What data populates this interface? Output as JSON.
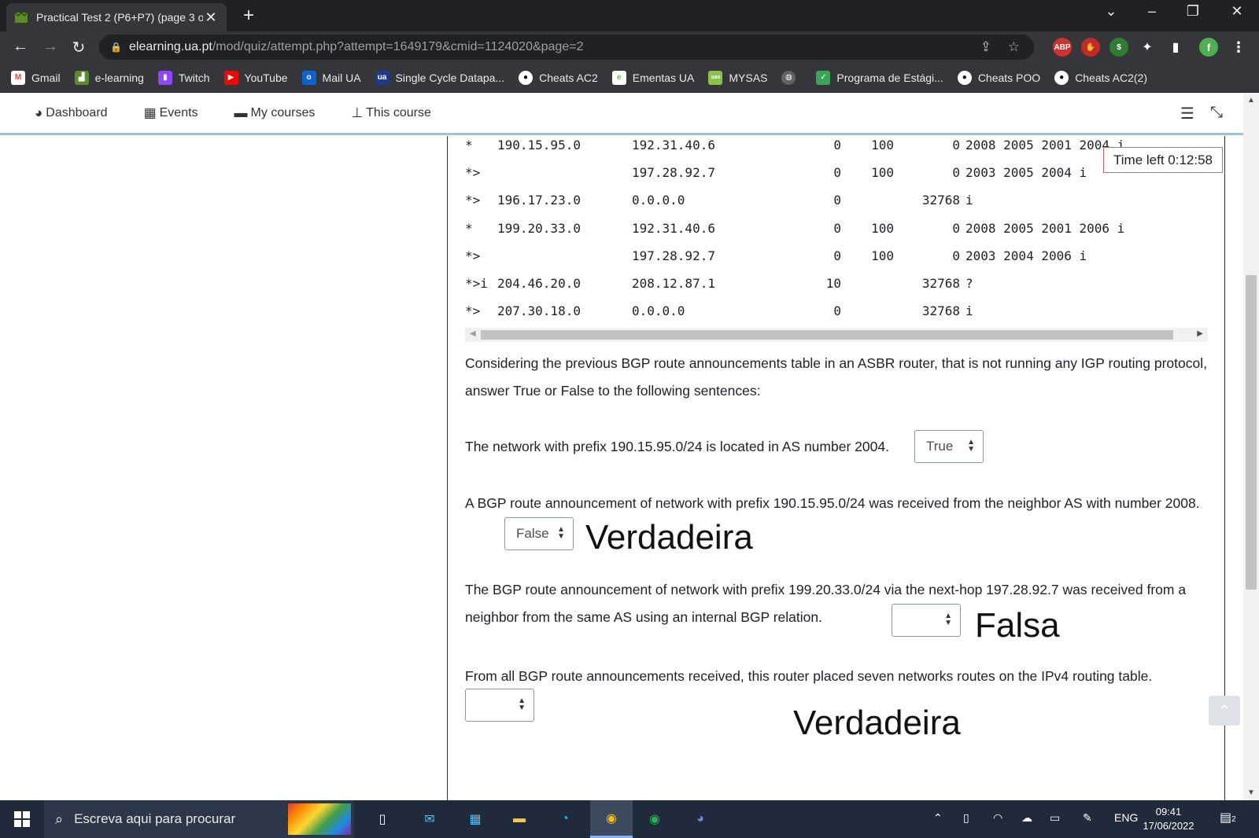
{
  "browser": {
    "tab_title": "Practical Test 2 (P6+P7) (page 3 o",
    "url_host": "elearning.ua.pt",
    "url_path": "/mod/quiz/attempt.php?attempt=1649179&cmid=1124020&page=2",
    "bookmarks": [
      {
        "label": "Gmail",
        "icon": "gmail-icon",
        "color": "#ea4335"
      },
      {
        "label": "e-learning",
        "icon": "elearning-icon",
        "color": "#5b8c2a"
      },
      {
        "label": "Twitch",
        "icon": "twitch-icon",
        "color": "#9146ff"
      },
      {
        "label": "YouTube",
        "icon": "youtube-icon",
        "color": "#ff0000"
      },
      {
        "label": "Mail UA",
        "icon": "outlook-icon",
        "color": "#0a64d6"
      },
      {
        "label": "Single Cycle Datapa...",
        "icon": "ua-icon",
        "color": "#1e3a8a"
      },
      {
        "label": "Cheats AC2",
        "icon": "github-icon",
        "color": "#ffffff"
      },
      {
        "label": "Ementas UA",
        "icon": "ementas-icon",
        "color": "#6fbf3b"
      },
      {
        "label": "MYSAS",
        "icon": "sas-icon",
        "color": "#8bc34a"
      },
      {
        "label": "",
        "icon": "globe-icon",
        "color": "#9aa0a6"
      },
      {
        "label": "Programa de Estági...",
        "icon": "programa-icon",
        "color": "#3aa655"
      },
      {
        "label": "Cheats POO",
        "icon": "github-icon",
        "color": "#ffffff"
      },
      {
        "label": "Cheats AC2(2)",
        "icon": "github-icon",
        "color": "#ffffff"
      }
    ]
  },
  "moodle_nav": {
    "items": [
      {
        "label": "Dashboard",
        "icon": "dashboard-icon"
      },
      {
        "label": "Events",
        "icon": "calendar-icon"
      },
      {
        "label": "My courses",
        "icon": "briefcase-icon"
      },
      {
        "label": "This course",
        "icon": "sitemap-icon"
      }
    ]
  },
  "route_table": [
    {
      "flag": "*",
      "network": "190.15.95.0",
      "next_hop": "192.31.40.6",
      "metric": "0",
      "locprf": "100",
      "weight": "0",
      "path": "2008 2005 2001 2004 i"
    },
    {
      "flag": "*>",
      "network": "",
      "next_hop": "197.28.92.7",
      "metric": "0",
      "locprf": "100",
      "weight": "0",
      "path": "2003 2005 2004 i"
    },
    {
      "flag": "*>",
      "network": "196.17.23.0",
      "next_hop": "0.0.0.0",
      "metric": "0",
      "locprf": "",
      "weight": "32768",
      "path": "i"
    },
    {
      "flag": "*",
      "network": "199.20.33.0",
      "next_hop": "192.31.40.6",
      "metric": "0",
      "locprf": "100",
      "weight": "0",
      "path": "2008 2005 2001 2006 i"
    },
    {
      "flag": "*>",
      "network": "",
      "next_hop": "197.28.92.7",
      "metric": "0",
      "locprf": "100",
      "weight": "0",
      "path": "2003 2004 2006 i"
    },
    {
      "flag": "*>i",
      "network": "204.46.20.0",
      "next_hop": "208.12.87.1",
      "metric": "10",
      "locprf": "",
      "weight": "32768",
      "path": "?"
    },
    {
      "flag": "*>",
      "network": "207.30.18.0",
      "next_hop": "0.0.0.0",
      "metric": "0",
      "locprf": "",
      "weight": "32768",
      "path": "i"
    }
  ],
  "timer": "Time left 0:12:58",
  "question": {
    "intro": "Considering the previous BGP route announcements table in an ASBR router, that is not running any IGP routing protocol, answer True or False to the following sentences:",
    "s1": "The network with prefix 190.15.95.0/24 is located in AS number 2004.",
    "s1_value": "True",
    "s2": "A BGP route announcement of network with prefix 190.15.95.0/24 was received from the neighbor AS with number 2008.",
    "s2_value": "False",
    "s3": "The BGP route announcement of network with prefix 199.20.33.0/24 via the next-hop 197.28.92.7 was received from a neighbor from the same AS using an internal BGP relation.",
    "s3_value": "",
    "s4": "From all BGP route announcements received, this router placed seven networks routes on the IPv4 routing table.",
    "s4_value": ""
  },
  "annotations": {
    "a1": "Verdadeira",
    "a2": "Falsa",
    "a3": "Verdadeira"
  },
  "taskbar": {
    "search_placeholder": "Escreva aqui para procurar",
    "language": "ENG",
    "time": "09:41",
    "date": "17/06/2022",
    "notifications": "2"
  }
}
